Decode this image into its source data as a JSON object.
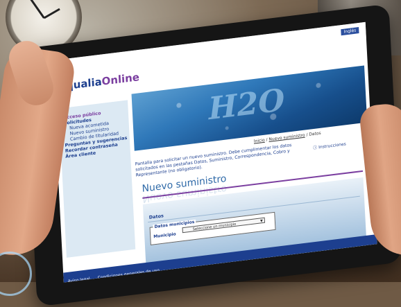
{
  "header": {
    "language_button": "Inglés"
  },
  "logo": {
    "part1": "aqualia",
    "part2": "Online"
  },
  "sidebar": {
    "items": [
      {
        "label": "Acceso público"
      },
      {
        "label": "Solicitudes"
      },
      {
        "label": "Nueva acometida"
      },
      {
        "label": "Nuevo suministro"
      },
      {
        "label": "Cambio de titularidad"
      },
      {
        "label": "Preguntas y sugerencias"
      },
      {
        "label": "Recordar contraseña"
      },
      {
        "label": "Área cliente"
      }
    ]
  },
  "banner": {
    "text": "H2O"
  },
  "breadcrumb": {
    "inicio": "Inicio",
    "sep1": " / ",
    "nuevo": "Nuevo suministro",
    "sep2": " / ",
    "datos": "Datos"
  },
  "intro_text": "Pantalla para solicitar un nuevo suministro. Debe cumplimentar los datos solicitados en las pestañas Datos, Suministro, Correspondencia, Cobro y Representante (no obligatorio).",
  "instructions_link": "Instrucciones",
  "page_title": "Nuevo suministro",
  "form": {
    "section_label": "Datos",
    "fieldset_legend": "Datos municipios",
    "municipio_label": "Municipio",
    "municipio_placeholder": "Seleccione un municipio"
  },
  "footer": {
    "legal": "Aviso legal",
    "conditions": "Condiciones generales de uso"
  },
  "colors": {
    "brand_blue": "#1d3f8f",
    "brand_purple": "#7b3fa0",
    "sidebar_bg": "#dce9f3"
  }
}
